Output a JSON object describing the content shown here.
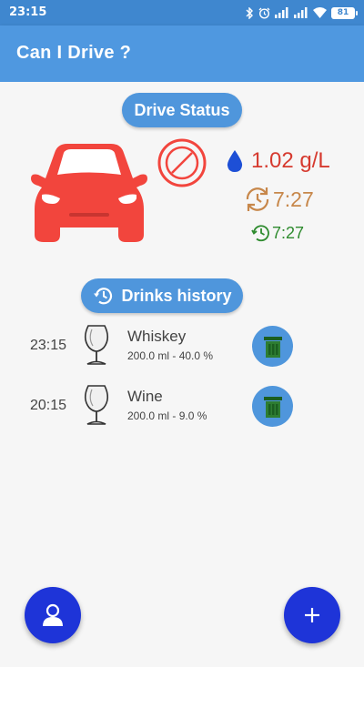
{
  "statusbar": {
    "time": "23:15",
    "battery": "81",
    "icons": [
      "bluetooth-icon",
      "alarm-icon",
      "signal-icon",
      "signal-icon",
      "wifi-icon",
      "battery-icon"
    ]
  },
  "appbar": {
    "title": "Can I Drive ?"
  },
  "drive_status": {
    "label": "Drive Status",
    "bac": "1.02 g/L",
    "time_sober": "7:27",
    "time_drive": "7:27",
    "car_color": "#f2453d",
    "no_drive_color": "#f2453d"
  },
  "history": {
    "label": "Drinks history",
    "drinks": [
      {
        "time": "23:15",
        "name": "Whiskey",
        "detail": "200.0 ml - 40.0 %"
      },
      {
        "time": "20:15",
        "name": "Wine",
        "detail": "200.0 ml - 9.0 %"
      }
    ]
  },
  "colors": {
    "appbar": "#4f98e0",
    "pill": "#4f96dc",
    "fab": "#1e34d8",
    "bac_text": "#d63a2f",
    "sober_time": "#c7874a",
    "drive_time": "#2e8b2e",
    "delete_icon": "#2e7d32"
  }
}
